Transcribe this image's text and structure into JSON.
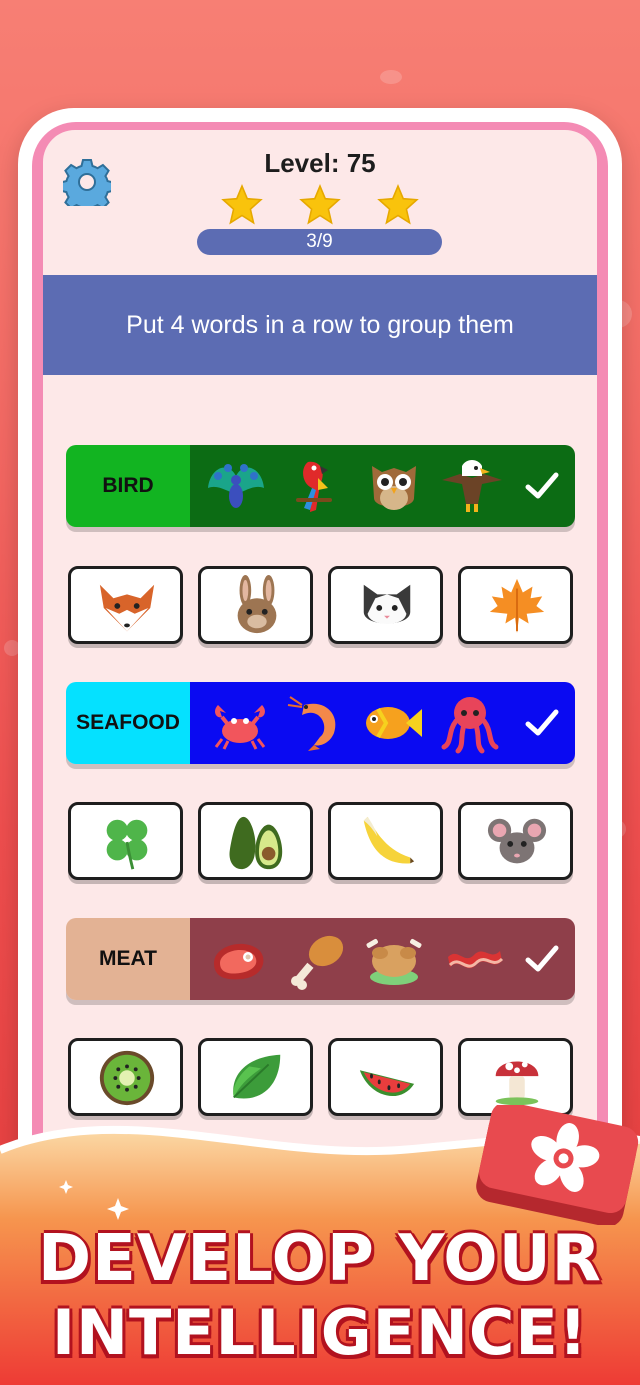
{
  "header": {
    "level_label": "Level: 75",
    "progress_text": "3/9",
    "stars_earned": 3,
    "stars_total": 3
  },
  "instruction": "Put 4 words in a row to group them",
  "groups": [
    {
      "label": "BIRD",
      "label_color": "#12b421",
      "body_color": "#0c6c14",
      "icons": [
        "peacock-icon",
        "parrot-icon",
        "owl-icon",
        "eagle-icon"
      ],
      "solved": true
    },
    {
      "label": "SEAFOOD",
      "label_color": "#05e1ff",
      "body_color": "#0a0af2",
      "icons": [
        "crab-icon",
        "shrimp-icon",
        "fish-icon",
        "octopus-icon"
      ],
      "solved": true
    },
    {
      "label": "MEAT",
      "label_color": "#e3b294",
      "body_color": "#8f3f4a",
      "icons": [
        "steak-icon",
        "drumstick-icon",
        "roast-chicken-icon",
        "bacon-icon"
      ],
      "solved": true
    }
  ],
  "tile_rows": [
    [
      "fox-icon",
      "rabbit-icon",
      "cat-icon",
      "maple-leaf-icon"
    ],
    [
      "clover-icon",
      "avocado-icon",
      "banana-icon",
      "mouse-icon"
    ],
    [
      "kiwi-icon",
      "leaf-icon",
      "watermelon-icon",
      "mushroom-icon"
    ]
  ],
  "promo": {
    "line1": "DEVELOP YOUR",
    "line2": "INTELLIGENCE!"
  },
  "colors": {
    "screen_bg": "#fde8e8",
    "accent_blue": "#5c6cb3",
    "frame_pink": "#f48bb4",
    "headline_outline": "#b2121f"
  }
}
